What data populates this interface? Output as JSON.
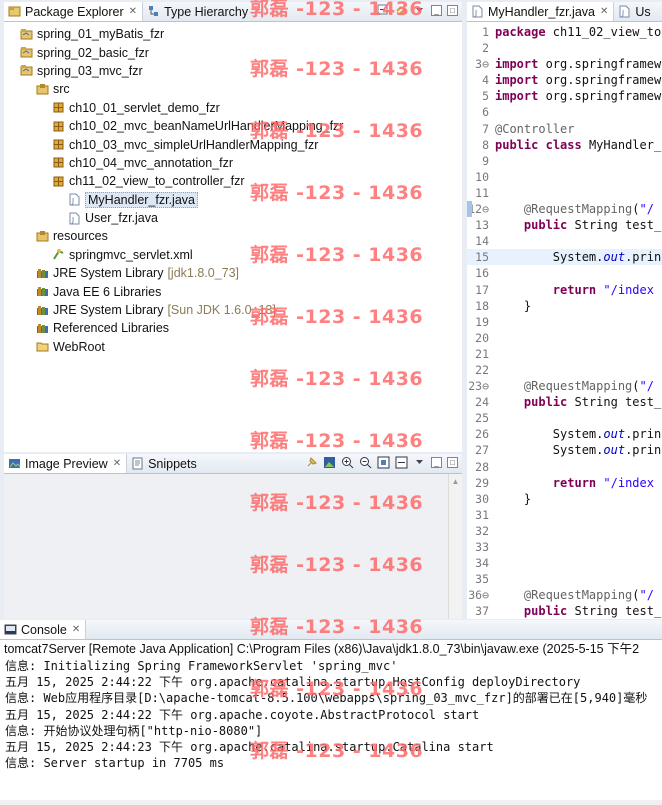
{
  "package_explorer": {
    "tabs": [
      {
        "label": "Package Explorer",
        "close": "✕"
      },
      {
        "label": "Type Hierarchy"
      }
    ],
    "tree": [
      {
        "label": "spring_01_myBatis_fzr",
        "depth": 1,
        "icon": "project-icon"
      },
      {
        "label": "spring_02_basic_fzr",
        "depth": 1,
        "icon": "project-icon"
      },
      {
        "label": "spring_03_mvc_fzr",
        "depth": 1,
        "icon": "project-icon"
      },
      {
        "label": "src",
        "depth": 2,
        "icon": "source-folder-icon"
      },
      {
        "label": "ch10_01_servlet_demo_fzr",
        "depth": 3,
        "icon": "package-icon"
      },
      {
        "label": "ch10_02_mvc_beanNameUrlHandlerMapping_fzr",
        "depth": 3,
        "icon": "package-icon"
      },
      {
        "label": "ch10_03_mvc_simpleUrlHandlerMapping_fzr",
        "depth": 3,
        "icon": "package-icon"
      },
      {
        "label": "ch10_04_mvc_annotation_fzr",
        "depth": 3,
        "icon": "package-icon"
      },
      {
        "label": "ch11_02_view_to_controller_fzr",
        "depth": 3,
        "icon": "package-icon"
      },
      {
        "label": "MyHandler_fzr.java",
        "depth": 4,
        "icon": "java-file-icon",
        "selected": true
      },
      {
        "label": "User_fzr.java",
        "depth": 4,
        "icon": "java-file-icon"
      },
      {
        "label": "resources",
        "depth": 2,
        "icon": "source-folder-icon"
      },
      {
        "label": "springmvc_servlet.xml",
        "depth": 3,
        "icon": "xml-file-icon"
      },
      {
        "label": "JRE System Library",
        "decoration": "[jdk1.8.0_73]",
        "depth": 2,
        "icon": "library-icon"
      },
      {
        "label": "Java EE 6 Libraries",
        "depth": 2,
        "icon": "library-icon"
      },
      {
        "label": "JRE System Library",
        "decoration": "[Sun JDK 1.6.0_13]",
        "depth": 2,
        "icon": "library-icon"
      },
      {
        "label": "Referenced Libraries",
        "depth": 2,
        "icon": "library-icon"
      },
      {
        "label": "WebRoot",
        "depth": 2,
        "icon": "folder-icon"
      }
    ]
  },
  "image_preview": {
    "tabs": [
      {
        "label": "Image Preview",
        "close": "✕"
      },
      {
        "label": "Snippets"
      }
    ]
  },
  "editor": {
    "tabs": [
      {
        "label": "MyHandler_fzr.java",
        "close": "✕"
      },
      {
        "label": "Us"
      }
    ],
    "lines": [
      {
        "n": "1",
        "html": "<span class='kw'>package</span> ch11_02_view_to"
      },
      {
        "n": "2",
        "html": ""
      },
      {
        "n": "3⊖",
        "html": "<span class='kw'>import</span> org.springframew"
      },
      {
        "n": "4",
        "html": "<span class='kw'>import</span> org.springframew"
      },
      {
        "n": "5",
        "html": "<span class='kw'>import</span> org.springframew"
      },
      {
        "n": "6",
        "html": ""
      },
      {
        "n": "7",
        "html": "<span class='ann'>@Controller</span>"
      },
      {
        "n": "8",
        "html": "<span class='kw'>public</span> <span class='kw'>class</span> MyHandler_"
      },
      {
        "n": "9",
        "html": ""
      },
      {
        "n": "10",
        "html": ""
      },
      {
        "n": "11",
        "html": ""
      },
      {
        "n": "12⊖",
        "html": "    <span class='ann'>@RequestMapping</span>(<span class='str'>\"/</span>",
        "mark": true
      },
      {
        "n": "13",
        "html": "    <span class='kw'>public</span> String test_"
      },
      {
        "n": "14",
        "html": ""
      },
      {
        "n": "15",
        "html": "        System.<span class='it'>out</span>.prin",
        "hl": true
      },
      {
        "n": "16",
        "html": ""
      },
      {
        "n": "17",
        "html": "        <span class='kw'>return</span> <span class='str'>\"/index</span>"
      },
      {
        "n": "18",
        "html": "    }"
      },
      {
        "n": "19",
        "html": ""
      },
      {
        "n": "20",
        "html": ""
      },
      {
        "n": "21",
        "html": ""
      },
      {
        "n": "22",
        "html": ""
      },
      {
        "n": "23⊖",
        "html": "    <span class='ann'>@RequestMapping</span>(<span class='str'>\"/</span>"
      },
      {
        "n": "24",
        "html": "    <span class='kw'>public</span> String test_"
      },
      {
        "n": "25",
        "html": ""
      },
      {
        "n": "26",
        "html": "        System.<span class='it'>out</span>.prin"
      },
      {
        "n": "27",
        "html": "        System.<span class='it'>out</span>.prin"
      },
      {
        "n": "28",
        "html": ""
      },
      {
        "n": "29",
        "html": "        <span class='kw'>return</span> <span class='str'>\"/index</span>"
      },
      {
        "n": "30",
        "html": "    }"
      },
      {
        "n": "31",
        "html": ""
      },
      {
        "n": "32",
        "html": ""
      },
      {
        "n": "33",
        "html": ""
      },
      {
        "n": "34",
        "html": ""
      },
      {
        "n": "35",
        "html": ""
      },
      {
        "n": "36⊖",
        "html": "    <span class='ann'>@RequestMapping</span>(<span class='str'>\"/</span>"
      },
      {
        "n": "37",
        "html": "    <span class='kw'>public</span> String test_"
      }
    ]
  },
  "console": {
    "tab_label": "Console",
    "close": "✕",
    "description": "tomcat7Server [Remote Java Application] C:\\Program Files (x86)\\Java\\jdk1.8.0_73\\bin\\javaw.exe (2025-5-15 下午2",
    "lines": [
      "信息: Initializing Spring FrameworkServlet 'spring_mvc'",
      "五月 15, 2025 2:44:22 下午 org.apache.catalina.startup.HostConfig deployDirectory",
      "信息: Web应用程序目录[D:\\apache-tomcat-8.5.100\\webapps\\spring_03_mvc_fzr]的部署已在[5,940]毫秒",
      "五月 15, 2025 2:44:22 下午 org.apache.coyote.AbstractProtocol start",
      "信息: 开始协议处理句柄[\"http-nio-8080\"]",
      "五月 15, 2025 2:44:23 下午 org.apache.catalina.startup.Catalina start",
      "信息: Server startup in 7705 ms"
    ]
  },
  "watermark": {
    "text": "郭磊 -123 - 1436",
    "color": "#ff6a6a"
  }
}
